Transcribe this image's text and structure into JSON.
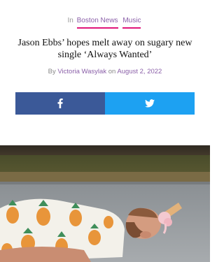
{
  "categories": {
    "prefix": "In",
    "items": [
      {
        "label": "Boston News"
      },
      {
        "label": "Music"
      }
    ]
  },
  "article": {
    "title": "Jason Ebbs’ hopes melt away on sugary new single ‘Always Wanted’",
    "byline_prefix": "By",
    "author": "Victoria Wasylak",
    "date_prefix": "on",
    "date": "August 2, 2022"
  },
  "share": {
    "facebook_icon": "facebook-f-icon",
    "twitter_icon": "twitter-bird-icon",
    "facebook_color": "#3b5998",
    "twitter_color": "#1da1f2"
  },
  "colors": {
    "accent_text": "#8a5fa8",
    "accent_underline": "#e0167a"
  }
}
